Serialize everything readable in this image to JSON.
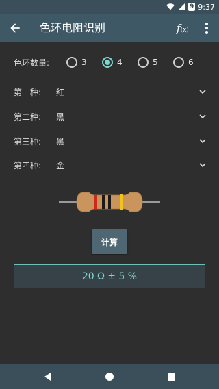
{
  "status_bar": {
    "time": "9:37",
    "battery_level": "9"
  },
  "app_bar": {
    "title": "色环电阻识别",
    "fx_main": "f",
    "fx_sub": "(x)"
  },
  "band_count": {
    "label": "色环数量:",
    "options": [
      "3",
      "4",
      "5",
      "6"
    ],
    "selected": "4"
  },
  "bands": [
    {
      "label": "第一种:",
      "value": "红"
    },
    {
      "label": "第二种:",
      "value": "黑"
    },
    {
      "label": "第三种:",
      "value": "黑"
    },
    {
      "label": "第四种:",
      "value": "金"
    }
  ],
  "resistor_colors": {
    "body": "#c9955c",
    "band1": "#d0271c",
    "band2": "#1a1a1a",
    "band3": "#1a1a1a",
    "band4": "#f2c31c"
  },
  "calculate_button": {
    "label": "计算"
  },
  "result": {
    "text": "20 Ω ± 5 %"
  },
  "colors": {
    "accent": "#7fd6cf",
    "app_bar": "#3f5866",
    "background": "#2e2e2e"
  },
  "icons": {
    "back": "arrow-left-icon",
    "fx": "function-icon",
    "more": "more-vert-icon",
    "chevron": "chevron-down-icon",
    "nav_back": "triangle-back-icon",
    "nav_home": "circle-home-icon",
    "nav_recents": "square-recents-icon"
  }
}
